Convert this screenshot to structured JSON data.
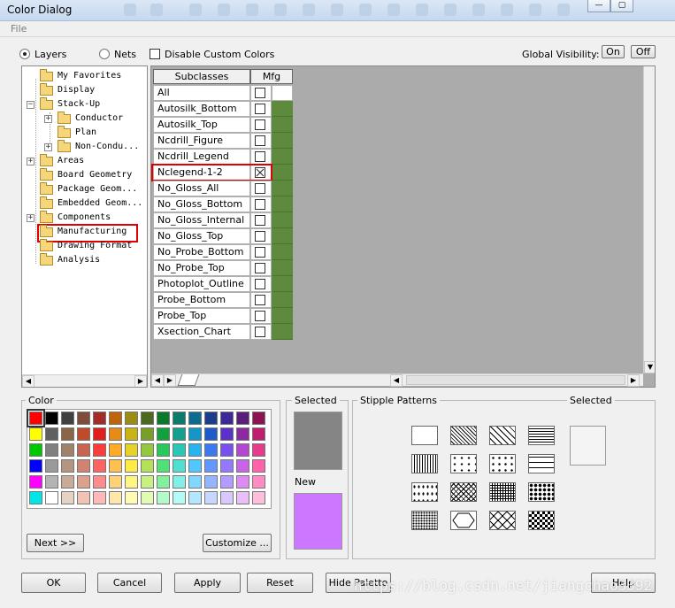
{
  "window": {
    "title": "Color Dialog",
    "minimize": "—",
    "maximize": "▢"
  },
  "menu": {
    "file": "File"
  },
  "mode": {
    "layers": "Layers",
    "nets": "Nets",
    "selected": "layers",
    "disable_custom": "Disable Custom Colors"
  },
  "global": {
    "label": "Global Visibility:",
    "on": "On",
    "off": "Off"
  },
  "tree": [
    {
      "label": "My Favorites",
      "level": 0,
      "expander": ""
    },
    {
      "label": "Display",
      "level": 0,
      "expander": ""
    },
    {
      "label": "Stack-Up",
      "level": 0,
      "expander": "−"
    },
    {
      "label": "Conductor",
      "level": 1,
      "expander": "+"
    },
    {
      "label": "Plan",
      "level": 1,
      "expander": ""
    },
    {
      "label": "Non-Condu...",
      "level": 1,
      "expander": "+"
    },
    {
      "label": "Areas",
      "level": 0,
      "expander": "+"
    },
    {
      "label": "Board Geometry",
      "level": 0,
      "expander": ""
    },
    {
      "label": "Package Geom...",
      "level": 0,
      "expander": ""
    },
    {
      "label": "Embedded Geom...",
      "level": 0,
      "expander": ""
    },
    {
      "label": "Components",
      "level": 0,
      "expander": "+"
    },
    {
      "label": "Manufacturing",
      "level": 0,
      "expander": "",
      "highlight": true
    },
    {
      "label": "Drawing Format",
      "level": 0,
      "expander": ""
    },
    {
      "label": "Analysis",
      "level": 0,
      "expander": ""
    }
  ],
  "grid": {
    "headers": [
      "Subclasses",
      "Mfg"
    ],
    "rows": [
      {
        "label": "All",
        "checked": false
      },
      {
        "label": "Autosilk_Bottom",
        "checked": false
      },
      {
        "label": "Autosilk_Top",
        "checked": false
      },
      {
        "label": "Ncdrill_Figure",
        "checked": false
      },
      {
        "label": "Ncdrill_Legend",
        "checked": false
      },
      {
        "label": "Nclegend-1-2",
        "checked": true,
        "highlight": true
      },
      {
        "label": "No_Gloss_All",
        "checked": false
      },
      {
        "label": "No_Gloss_Bottom",
        "checked": false
      },
      {
        "label": "No_Gloss_Internal",
        "checked": false
      },
      {
        "label": "No_Gloss_Top",
        "checked": false
      },
      {
        "label": "No_Probe_Bottom",
        "checked": false
      },
      {
        "label": "No_Probe_Top",
        "checked": false
      },
      {
        "label": "Photoplot_Outline",
        "checked": false
      },
      {
        "label": "Probe_Bottom",
        "checked": false
      },
      {
        "label": "Probe_Top",
        "checked": false
      },
      {
        "label": "Xsection_Chart",
        "checked": false
      }
    ],
    "mfg_color": "#5d8a3c"
  },
  "color": {
    "group_label": "Color",
    "rows": [
      [
        "#ff0000",
        "#000000",
        "#404040",
        "#7f4b3a",
        "#a52a2a",
        "#c0640a",
        "#9b8c14",
        "#4c6a1e",
        "#0a7a2a",
        "#0b7b6b",
        "#0a6d8f",
        "#1e3c8c",
        "#3c2896",
        "#5a1e7a",
        "#8c1450"
      ],
      [
        "#ffff00",
        "#606060",
        "#8c6446",
        "#c04b2a",
        "#e01e1e",
        "#e68c14",
        "#c8b414",
        "#78a028",
        "#14a03c",
        "#14a08c",
        "#1496c8",
        "#1e5ac8",
        "#5a32c8",
        "#8c28a0",
        "#c01e6e"
      ],
      [
        "#00c800",
        "#808080",
        "#a0826a",
        "#c86450",
        "#ff3c3c",
        "#ffaa28",
        "#e6d228",
        "#96c83c",
        "#28c85a",
        "#28c8b4",
        "#28b4f0",
        "#3c78f0",
        "#7850f0",
        "#b446d2",
        "#e63c8c"
      ],
      [
        "#0000ff",
        "#9a9a9a",
        "#b49680",
        "#d28270",
        "#ff6464",
        "#ffc050",
        "#ffeb46",
        "#b4e05a",
        "#50e078",
        "#50e0d2",
        "#50c8ff",
        "#6496ff",
        "#9678ff",
        "#c864e6",
        "#ff64aa"
      ],
      [
        "#ff00ff",
        "#b4b4b4",
        "#c8aa96",
        "#dca08c",
        "#ff8c8c",
        "#ffd27a",
        "#fff582",
        "#c8f082",
        "#82f09c",
        "#82f0e6",
        "#82d7ff",
        "#96b4ff",
        "#b49bff",
        "#dc8cf0",
        "#ff8cc3"
      ],
      [
        "#00e6e6",
        "#ffffff",
        "#e6d2c3",
        "#f0c3b4",
        "#ffb9b9",
        "#ffe6aa",
        "#fffab4",
        "#e1fab4",
        "#b4fac8",
        "#b4faf5",
        "#b4e6ff",
        "#c8d7ff",
        "#d7c8ff",
        "#ebbef8",
        "#ffbedc"
      ]
    ],
    "selected_index": [
      0,
      0
    ],
    "next_button": "Next >>",
    "customize_button": "Customize ..."
  },
  "preview": {
    "selected_label": "Selected",
    "selected_color": "#858585",
    "new_label": "New",
    "new_color": "#cc77ff"
  },
  "stipple": {
    "group_label": "Stipple Patterns",
    "selected_label": "Selected",
    "patterns": [
      "solid-pattern",
      "diagonal-lines-pattern",
      "wide-diagonal-pattern",
      "horizontal-lines-pattern",
      "vertical-lines-pattern",
      "scattered-dots-pattern",
      "plus-dots-pattern",
      "dashed-lines-pattern",
      "sparse-dots-pattern",
      "cross-hatch-pattern",
      "grid-pattern",
      "dense-dots-pattern",
      "fine-dots-pattern",
      "octagon-pattern",
      "x-cross-pattern",
      "diamond-checker-pattern"
    ]
  },
  "buttons": {
    "ok": "OK",
    "cancel": "Cancel",
    "apply": "Apply",
    "reset": "Reset",
    "hide_palette": "Hide Palette",
    "help": "Help"
  },
  "watermark": "https://blog.csdn.net/jiangchao3392"
}
